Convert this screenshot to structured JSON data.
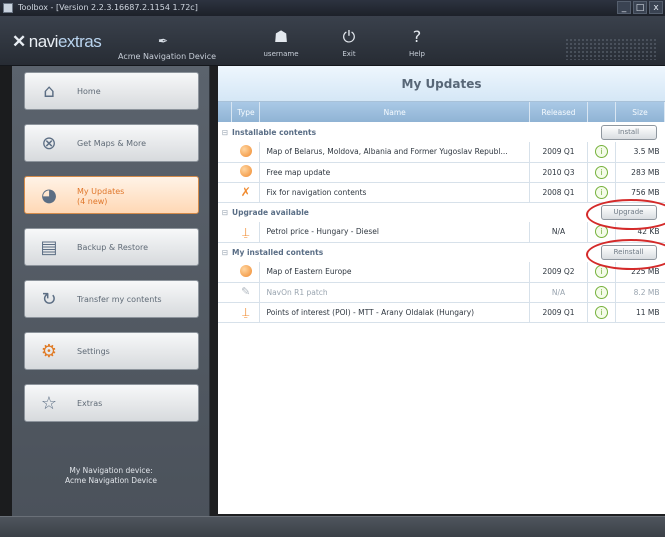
{
  "window": {
    "title": "Toolbox - [Version 2.2.3.16687.2.1154 1.72c]",
    "controls": [
      "_",
      "□",
      "x"
    ]
  },
  "topbar": {
    "logo_a": "navi",
    "logo_b": "extras",
    "device_name": "Acme Navigation Device",
    "buttons": [
      {
        "label": "username",
        "icon": "user-icon"
      },
      {
        "label": "Exit",
        "icon": "power-icon"
      },
      {
        "label": "Help",
        "icon": "help-icon"
      }
    ]
  },
  "sidebar": {
    "items": [
      {
        "label": "Home",
        "icon": "home-icon"
      },
      {
        "label": "Get Maps & More",
        "icon": "arrow-circle-icon"
      },
      {
        "label": "My Updates",
        "sublabel": "(4 new)",
        "icon": "updates-icon",
        "active": true
      },
      {
        "label": "Backup & Restore",
        "icon": "backup-icon"
      },
      {
        "label": "Transfer my contents",
        "icon": "transfer-icon"
      },
      {
        "label": "Settings",
        "icon": "gear-icon"
      },
      {
        "label": "Extras",
        "icon": "star-icon"
      }
    ],
    "device_info_line1": "My Navigation device:",
    "device_info_line2": "Acme Navigation Device"
  },
  "main": {
    "title": "My Updates",
    "columns": {
      "type": "Type",
      "name": "Name",
      "released": "Released",
      "size": "Size"
    },
    "groups": {
      "installable": {
        "label": "Installable contents",
        "action": "Install",
        "rows": [
          {
            "type": "map",
            "name": "Map of Belarus, Moldova, Albania and Former Yugoslav Republ...",
            "released": "2009 Q1",
            "size": "3.5 MB"
          },
          {
            "type": "map",
            "name": "Free map update",
            "released": "2010 Q3",
            "size": "283 MB"
          },
          {
            "type": "fix",
            "name": "Fix for navigation contents",
            "released": "2008 Q1",
            "size": "756 MB"
          }
        ]
      },
      "upgrade": {
        "label": "Upgrade available",
        "action": "Upgrade",
        "rows": [
          {
            "type": "poi",
            "name": "Petrol price - Hungary - Diesel",
            "released": "N/A",
            "size": "42 KB"
          }
        ]
      },
      "installed": {
        "label": "My installed contents",
        "action": "Reinstall",
        "rows": [
          {
            "type": "map",
            "name": "Map of Eastern Europe",
            "released": "2009 Q2",
            "size": "225 MB"
          },
          {
            "type": "patch",
            "name": "NavOn R1 patch",
            "released": "N/A",
            "size": "8.2 MB"
          },
          {
            "type": "poi",
            "name": "Points of interest (POI) - MTT - Arany Oldalak (Hungary)",
            "released": "2009 Q1",
            "size": "11 MB"
          }
        ]
      }
    },
    "collapse_symbol": "⊟",
    "info_symbol": "i"
  },
  "colors": {
    "accent": "#e0772b",
    "header_blue": "#9dbfdf",
    "annotation_red": "#d42a2a"
  }
}
